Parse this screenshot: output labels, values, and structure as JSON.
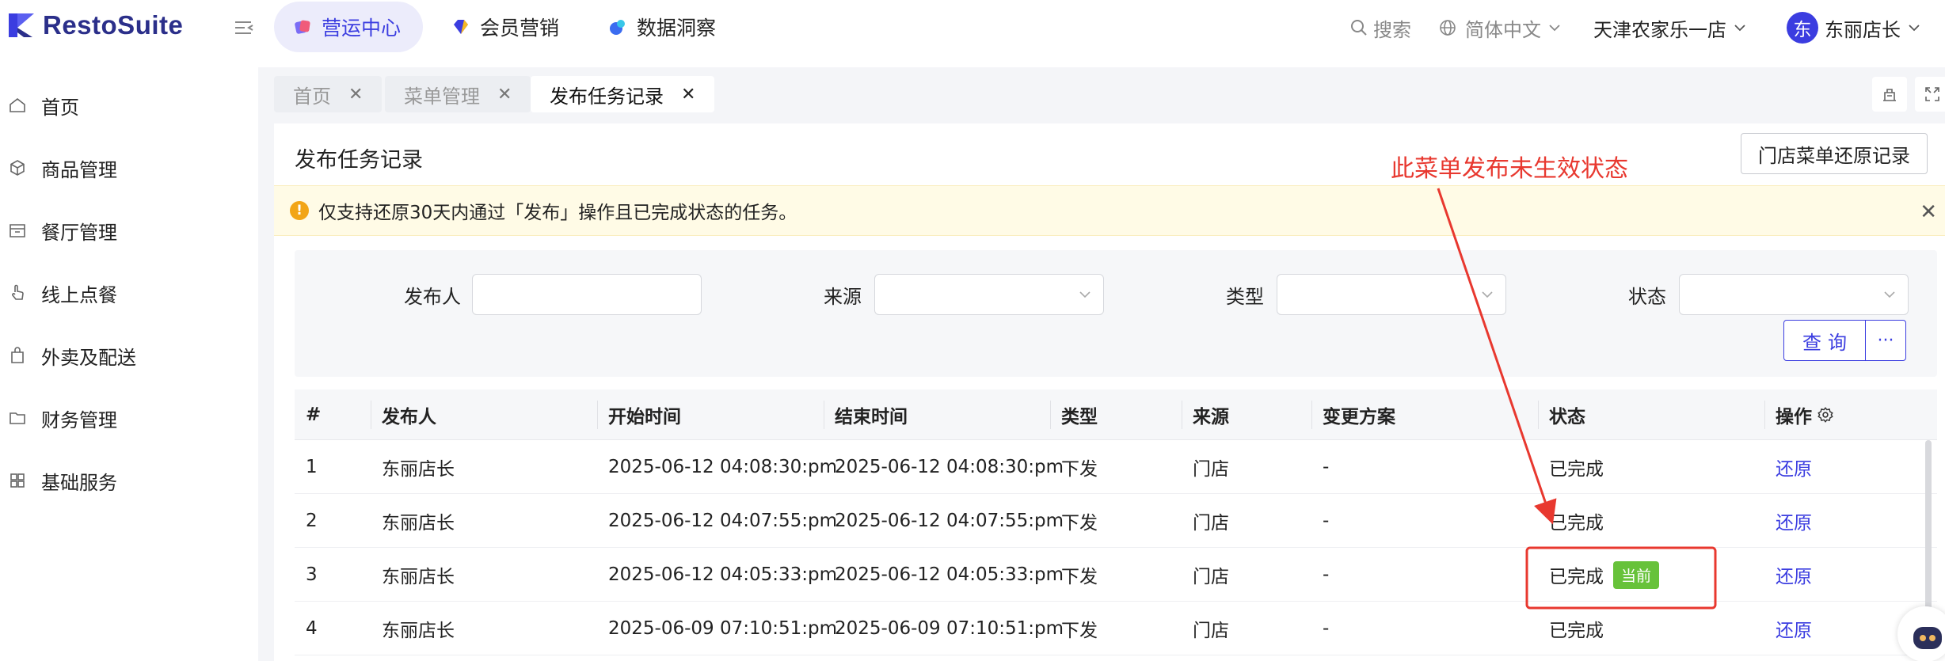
{
  "app": {
    "name": "RestoSuite"
  },
  "modules": [
    {
      "label": "营运中心",
      "active": true
    },
    {
      "label": "会员营销",
      "active": false
    },
    {
      "label": "数据洞察",
      "active": false
    }
  ],
  "header": {
    "search_label": "搜索",
    "language": "简体中文",
    "store": "天津农家乐一店",
    "avatar_char": "东",
    "user": "东丽店长"
  },
  "sidebar": {
    "items": [
      {
        "label": "首页",
        "icon": "home-icon"
      },
      {
        "label": "商品管理",
        "icon": "cube-icon"
      },
      {
        "label": "餐厅管理",
        "icon": "store-icon"
      },
      {
        "label": "线上点餐",
        "icon": "hand-pointer-icon"
      },
      {
        "label": "外卖及配送",
        "icon": "bag-icon"
      },
      {
        "label": "财务管理",
        "icon": "folder-icon"
      },
      {
        "label": "基础服务",
        "icon": "grid-icon"
      }
    ]
  },
  "page_tabs": [
    {
      "label": "首页",
      "active": false
    },
    {
      "label": "菜单管理",
      "active": false
    },
    {
      "label": "发布任务记录",
      "active": true
    }
  ],
  "page": {
    "title": "发布任务记录",
    "restore_records_button": "门店菜单还原记录",
    "notice": "仅支持还原30天内通过「发布」操作且已完成状态的任务。"
  },
  "filters": {
    "publisher_label": "发布人",
    "source_label": "来源",
    "type_label": "类型",
    "status_label": "状态",
    "query_button": "查询",
    "more_button": "···"
  },
  "table": {
    "columns": [
      "#",
      "发布人",
      "开始时间",
      "结束时间",
      "类型",
      "来源",
      "变更方案",
      "状态",
      "操作"
    ],
    "rows": [
      {
        "no": "1",
        "publisher": "东丽店长",
        "start": "2025-06-12 04:08:30:pm",
        "end": "2025-06-12 04:08:30:pm",
        "type": "下发",
        "source": "门店",
        "plan": "-",
        "status": "已完成",
        "badge": "",
        "action": "还原"
      },
      {
        "no": "2",
        "publisher": "东丽店长",
        "start": "2025-06-12 04:07:55:pm",
        "end": "2025-06-12 04:07:55:pm",
        "type": "下发",
        "source": "门店",
        "plan": "-",
        "status": "已完成",
        "badge": "",
        "action": "还原"
      },
      {
        "no": "3",
        "publisher": "东丽店长",
        "start": "2025-06-12 04:05:33:pm",
        "end": "2025-06-12 04:05:33:pm",
        "type": "下发",
        "source": "门店",
        "plan": "-",
        "status": "已完成",
        "badge": "当前",
        "action": "还原"
      },
      {
        "no": "4",
        "publisher": "东丽店长",
        "start": "2025-06-09 07:10:51:pm",
        "end": "2025-06-09 07:10:51:pm",
        "type": "下发",
        "source": "门店",
        "plan": "-",
        "status": "已完成",
        "badge": "",
        "action": "还原"
      }
    ]
  },
  "annotation": {
    "text": "此菜单发布未生效状态",
    "color": "#e8382f"
  },
  "colors": {
    "accent": "#3b3de0",
    "notice_bg": "#fffbe6",
    "warn": "#f2a516",
    "badge": "#67c23a"
  }
}
